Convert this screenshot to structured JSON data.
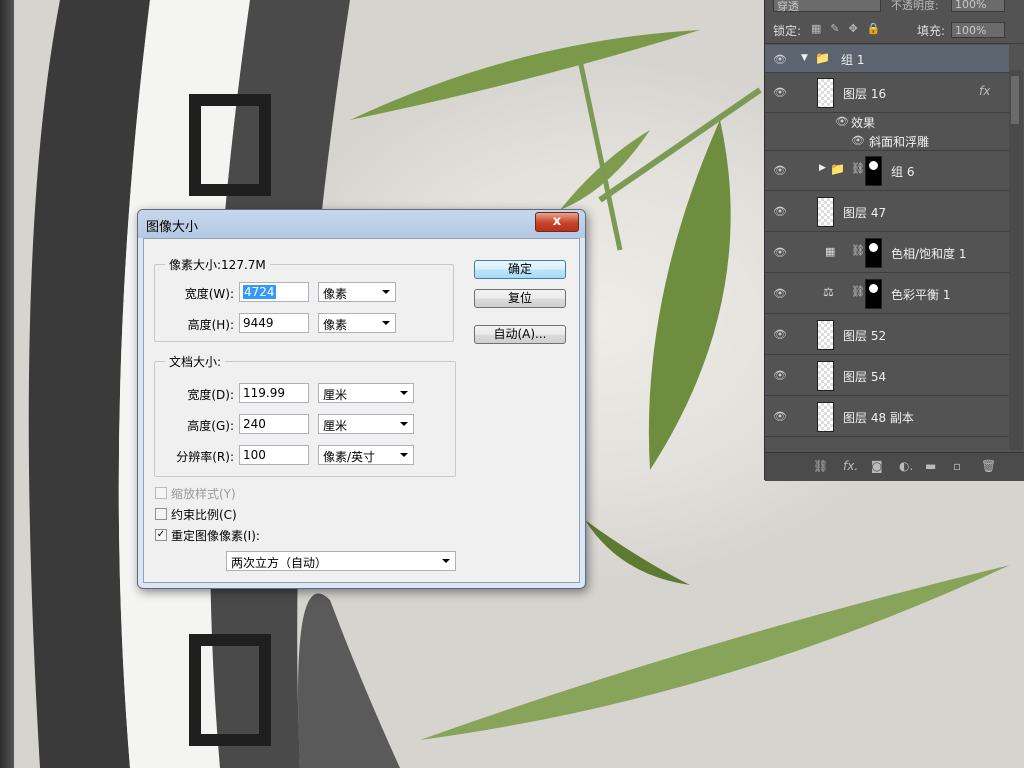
{
  "dialog": {
    "title": "图像大小",
    "close_label": "x",
    "pixel_dimensions": {
      "legend": "像素大小:127.7M",
      "width_label": "宽度(W):",
      "width_value": "4724",
      "width_unit": "像素",
      "height_label": "高度(H):",
      "height_value": "9449",
      "height_unit": "像素"
    },
    "document_size": {
      "legend": "文档大小:",
      "width_label": "宽度(D):",
      "width_value": "119.99",
      "width_unit": "厘米",
      "height_label": "高度(G):",
      "height_value": "240",
      "height_unit": "厘米",
      "resolution_label": "分辨率(R):",
      "resolution_value": "100",
      "resolution_unit": "像素/英寸"
    },
    "options": {
      "scale_styles": "缩放样式(Y)",
      "constrain_proportions": "约束比例(C)",
      "resample_image": "重定图像像素(I):",
      "resample_checked": "✓",
      "resample_method": "两次立方（自动）"
    },
    "buttons": {
      "ok": "确定",
      "reset": "复位",
      "auto": "自动(A)..."
    }
  },
  "layers_panel": {
    "blend_mode": "穿透",
    "opacity_label": "不透明度:",
    "opacity_value": "100%",
    "lock_label": "锁定:",
    "fill_label": "填充:",
    "fill_value": "100%",
    "rows": [
      {
        "name": "组 1"
      },
      {
        "name": "图层 16",
        "fx": "fx"
      },
      {
        "name": "效果"
      },
      {
        "name": "斜面和浮雕"
      },
      {
        "name": "组 6"
      },
      {
        "name": "图层 47"
      },
      {
        "name": "色相/饱和度 1"
      },
      {
        "name": "色彩平衡 1"
      },
      {
        "name": "图层 52"
      },
      {
        "name": "图层 54"
      },
      {
        "name": "图层 48 副本"
      }
    ],
    "bottom_icons": [
      "link-icon",
      "fx-icon",
      "mask-icon",
      "adjustment-icon",
      "folder-icon",
      "new-layer-icon",
      "trash-icon"
    ]
  }
}
